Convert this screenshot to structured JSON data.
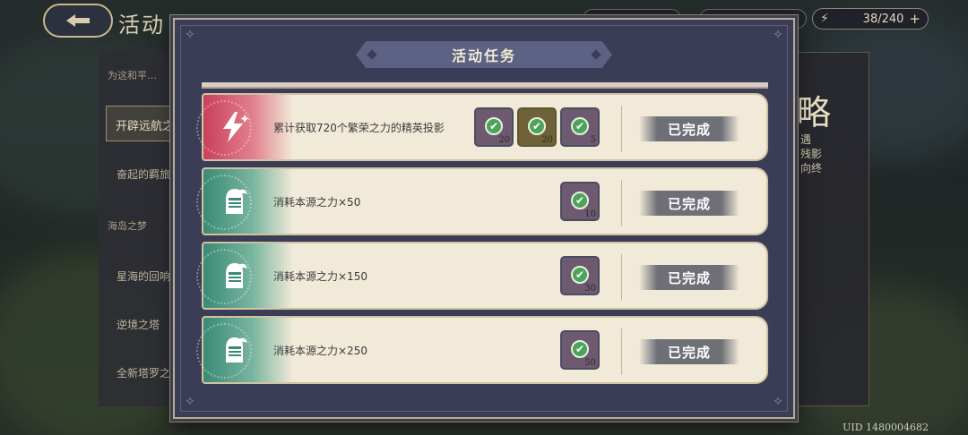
{
  "header": {
    "back_icon": "back-arrow-icon",
    "title": "活动",
    "stamina_value": "38/240",
    "stamina_plus": "+"
  },
  "left_panel": {
    "group1_title": "为这和平…",
    "active_item": "开辟远航之…",
    "item2": "奋起的羁旅…",
    "group2_title": "海岛之梦",
    "item3": "星海的回响…",
    "item4": "逆境之塔",
    "item5": "全新塔罗之…"
  },
  "right_panel": {
    "big_char": "略",
    "line1": "遇",
    "line2": "残影",
    "line3": "向终"
  },
  "modal": {
    "title": "活动任务",
    "tasks": [
      {
        "description": "累计获取720个繁荣之力的精英投影",
        "status": "已完成",
        "rewards": [
          {
            "qty": "20"
          },
          {
            "qty": "20"
          },
          {
            "qty": "5"
          }
        ]
      },
      {
        "description": "消耗本源之力×50",
        "status": "已完成",
        "rewards": [
          {
            "qty": "10"
          }
        ]
      },
      {
        "description": "消耗本源之力×150",
        "status": "已完成",
        "rewards": [
          {
            "qty": "30"
          }
        ]
      },
      {
        "description": "消耗本源之力×250",
        "status": "已完成",
        "rewards": [
          {
            "qty": "50"
          }
        ]
      }
    ]
  },
  "footer": {
    "uid": "UID 1480004682"
  },
  "colors": {
    "modal_bg": "#3a3d55",
    "row_bg": "#f1ead8",
    "red_icon": "#c9405a",
    "green_icon": "#3a8a75",
    "check_green": "#4da35a",
    "badge_gray": "#6f6f78"
  }
}
